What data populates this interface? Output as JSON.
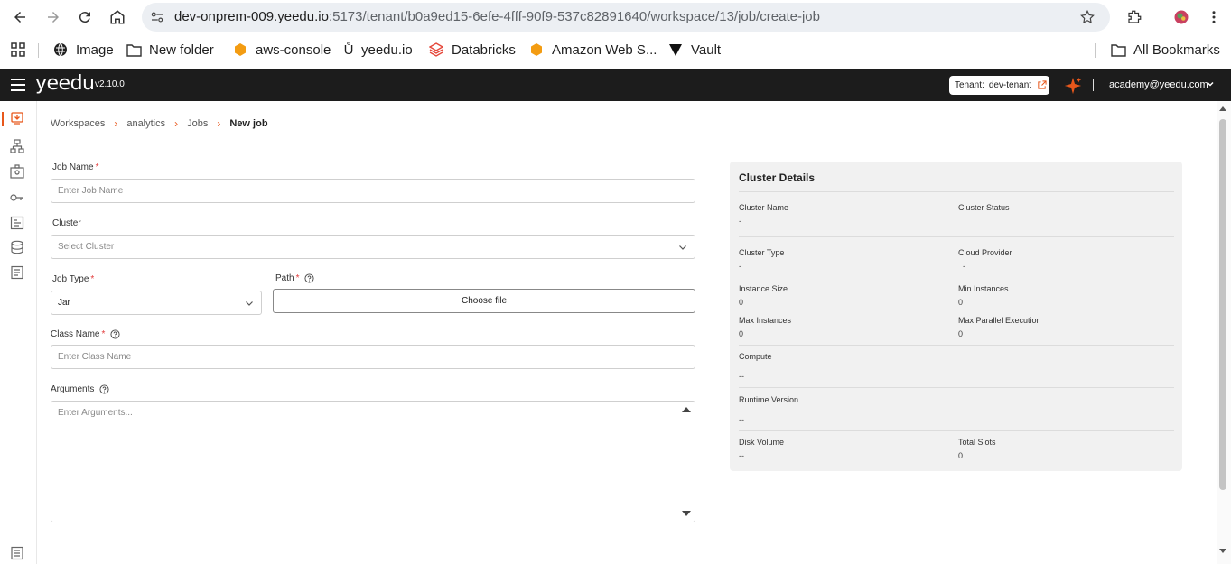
{
  "browser": {
    "url_host": "dev-onprem-009.yeedu.io",
    "url_rest": ":5173/tenant/b0a9ed15-6efe-4fff-90f9-537c82891640/workspace/13/job/create-job",
    "bookmarks": [
      {
        "label": "Image",
        "icon": "globe-icon"
      },
      {
        "label": "New folder",
        "icon": "folder-icon"
      },
      {
        "label": "aws-console",
        "icon": "aws-icon"
      },
      {
        "label": "yeedu.io",
        "icon": "yeedu-icon"
      },
      {
        "label": "Databricks",
        "icon": "databricks-icon"
      },
      {
        "label": "Amazon Web S...",
        "icon": "aws-icon"
      },
      {
        "label": "Vault",
        "icon": "vault-icon"
      }
    ],
    "all_bookmarks": "All Bookmarks"
  },
  "header": {
    "logo": "yeedu",
    "version": "v2.10.0",
    "tenant_label": "Tenant:",
    "tenant_name": "dev-tenant",
    "user_email": "academy@yeedu.com"
  },
  "breadcrumb": {
    "items": [
      "Workspaces",
      "analytics",
      "Jobs"
    ],
    "current": "New job"
  },
  "form": {
    "job_name_label": "Job Name",
    "job_name_placeholder": "Enter Job Name",
    "cluster_label": "Cluster",
    "cluster_placeholder": "Select Cluster",
    "job_type_label": "Job Type",
    "job_type_value": "Jar",
    "path_label": "Path",
    "choose_file": "Choose file",
    "class_name_label": "Class Name",
    "class_name_placeholder": "Enter Class Name",
    "arguments_label": "Arguments",
    "arguments_placeholder": "Enter Arguments..."
  },
  "cluster_details": {
    "title": "Cluster Details",
    "cluster_name_key": "Cluster Name",
    "cluster_name_val": "-",
    "cluster_status_key": "Cluster Status",
    "cluster_status_val": "",
    "cluster_type_key": "Cluster Type",
    "cluster_type_val": "-",
    "cloud_provider_key": "Cloud Provider",
    "cloud_provider_val": "-",
    "instance_size_key": "Instance Size",
    "instance_size_val": "0",
    "min_instances_key": "Min Instances",
    "min_instances_val": "0",
    "max_instances_key": "Max Instances",
    "max_instances_val": "0",
    "max_parallel_key": "Max Parallel Execution",
    "max_parallel_val": "0",
    "compute_key": "Compute",
    "compute_val": "--",
    "runtime_key": "Runtime Version",
    "runtime_val": "--",
    "disk_key": "Disk Volume",
    "disk_val": "--",
    "slots_key": "Total Slots",
    "slots_val": "0"
  },
  "colors": {
    "accent": "#e8571b",
    "header_bg": "#1c1c1c",
    "required": "#e23c3c"
  }
}
